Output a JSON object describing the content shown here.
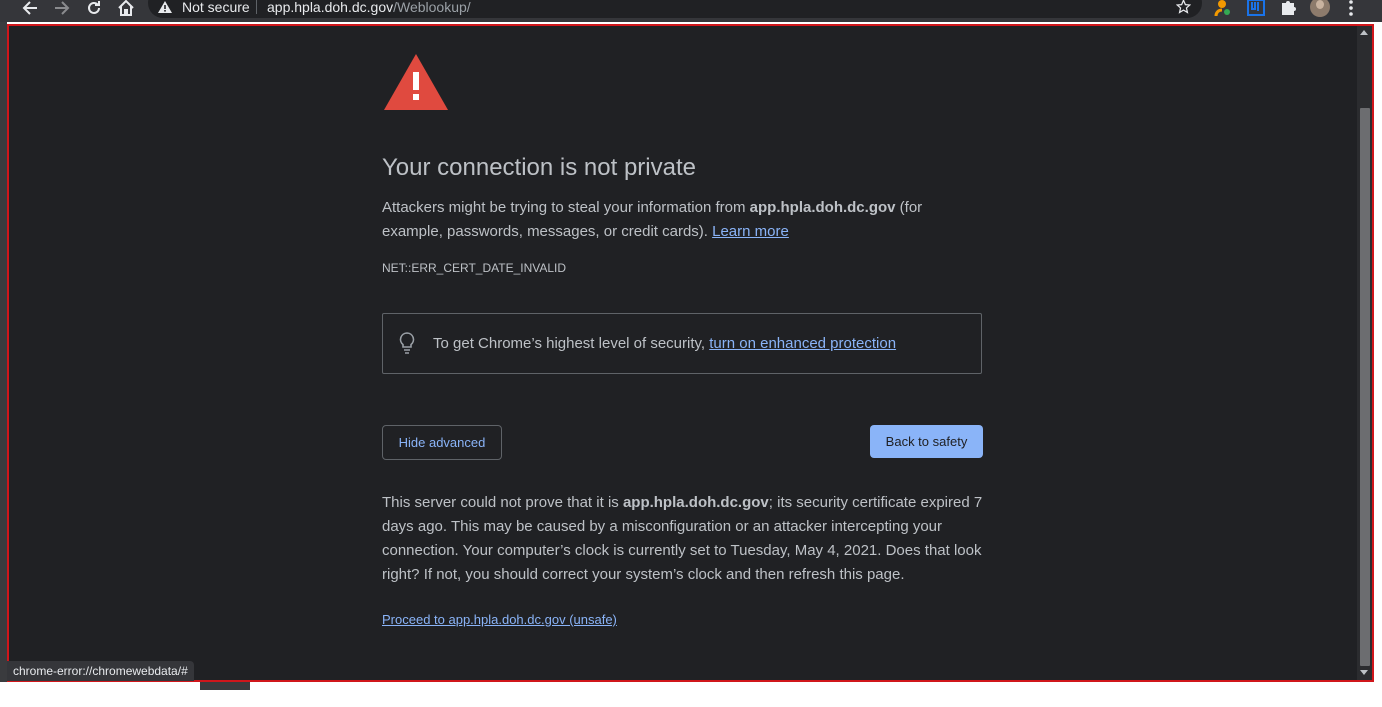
{
  "browser": {
    "security_label": "Not secure",
    "url_host": "app.hpla.doh.dc.gov",
    "url_path": "/Weblookup/",
    "icons": [
      "back-icon",
      "forward-icon",
      "reload-icon",
      "home-icon",
      "warning-icon",
      "star-icon",
      "extension-icon",
      "puzzle-icon",
      "profile-avatar",
      "menu-icon"
    ]
  },
  "page": {
    "heading": "Your connection is not private",
    "explanation_prefix": "Attackers might be trying to steal your information from ",
    "explanation_host": "app.hpla.doh.dc.gov",
    "explanation_suffix": " (for example, passwords, messages, or credit cards). ",
    "learn_more": "Learn more",
    "error_code": "NET::ERR_CERT_DATE_INVALID",
    "enhanced_prefix": "To get Chrome’s highest level of security, ",
    "enhanced_link": "turn on enhanced protection",
    "hide_advanced": "Hide advanced",
    "back_to_safety": "Back to safety",
    "details_prefix": "This server could not prove that it is ",
    "details_host": "app.hpla.doh.dc.gov",
    "details_suffix": "; its security certificate expired 7 days ago. This may be caused by a misconfiguration or an attacker intercepting your connection. Your computer’s clock is currently set to Tuesday, May 4, 2021. Does that look right? If not, you should correct your system’s clock and then refresh this page.",
    "proceed_link": "Proceed to app.hpla.doh.dc.gov (unsafe)"
  },
  "status_bar": {
    "text": "chrome-error://chromewebdata/#"
  },
  "colors": {
    "page_bg": "#202124",
    "text": "#bdc1c6",
    "link": "#8ab4f8",
    "warning_red": "#e04a3f",
    "frame_red": "#d0161b"
  }
}
